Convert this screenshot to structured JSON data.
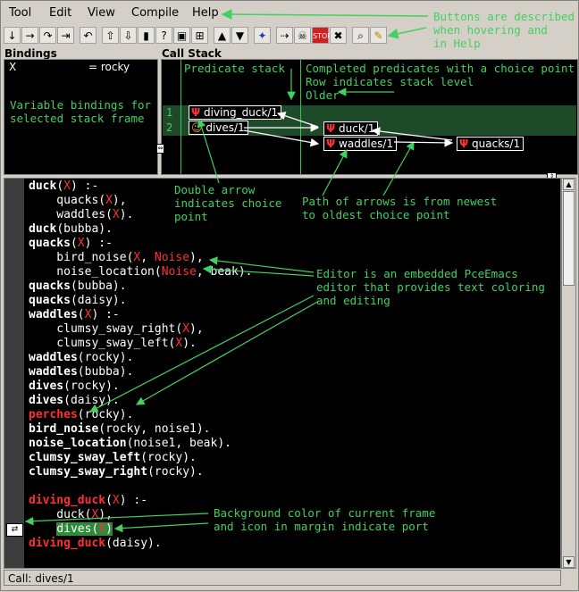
{
  "menu": [
    "Tool",
    "Edit",
    "View",
    "Compile",
    "Help"
  ],
  "toolbar_icons": [
    "step-into-icon",
    "step-over-icon",
    "skip-icon",
    "finish-icon",
    "nodebug-icon",
    "retry-icon",
    "up-icon",
    "down-icon",
    "leap-icon",
    "print-icon",
    "query-icon",
    "abort-icon",
    "break-icon",
    "browse-icon",
    "stack-up-icon",
    "stack-down-icon",
    "spy-icon",
    "nodebug-exit-icon",
    "nodebug-abort-icon",
    "stop-icon",
    "close-icon",
    "search-icon",
    "edit-icon"
  ],
  "panes": {
    "bindings_title": "Bindings",
    "stack_title": "Call Stack"
  },
  "bindings": {
    "var": "X",
    "value": "= rocky"
  },
  "stack": {
    "levels": [
      "1",
      "2"
    ],
    "frames": [
      {
        "label": "diving_duck/1"
      },
      {
        "label": "dives/1"
      },
      {
        "label": "duck/1"
      },
      {
        "label": "waddles/1"
      },
      {
        "label": "quacks/1"
      }
    ]
  },
  "code_lines": [
    [
      {
        "t": "duck",
        "c": "b"
      },
      {
        "t": "("
      },
      {
        "t": "X",
        "c": "r"
      },
      {
        "t": ") :-"
      }
    ],
    [
      {
        "t": "    quacks("
      },
      {
        "t": "X",
        "c": "r"
      },
      {
        "t": "),"
      }
    ],
    [
      {
        "t": "    waddles("
      },
      {
        "t": "X",
        "c": "r"
      },
      {
        "t": ")."
      }
    ],
    [
      {
        "t": "duck",
        "c": "b"
      },
      {
        "t": "(bubba)."
      }
    ],
    [
      {
        "t": "quacks",
        "c": "b"
      },
      {
        "t": "("
      },
      {
        "t": "X",
        "c": "r"
      },
      {
        "t": ") :-"
      }
    ],
    [
      {
        "t": "    bird_noise("
      },
      {
        "t": "X",
        "c": "r"
      },
      {
        "t": ", "
      },
      {
        "t": "Noise",
        "c": "r"
      },
      {
        "t": "),"
      }
    ],
    [
      {
        "t": "    noise_location("
      },
      {
        "t": "Noise",
        "c": "r"
      },
      {
        "t": ", beak)."
      }
    ],
    [
      {
        "t": "quacks",
        "c": "b"
      },
      {
        "t": "(bubba)."
      }
    ],
    [
      {
        "t": "quacks",
        "c": "b"
      },
      {
        "t": "(daisy)."
      }
    ],
    [
      {
        "t": "waddles",
        "c": "b"
      },
      {
        "t": "("
      },
      {
        "t": "X",
        "c": "r"
      },
      {
        "t": ") :-"
      }
    ],
    [
      {
        "t": "    clumsy_sway_right("
      },
      {
        "t": "X",
        "c": "r"
      },
      {
        "t": "),"
      }
    ],
    [
      {
        "t": "    clumsy_sway_left("
      },
      {
        "t": "X",
        "c": "r"
      },
      {
        "t": ")."
      }
    ],
    [
      {
        "t": "waddles",
        "c": "b"
      },
      {
        "t": "(rocky)."
      }
    ],
    [
      {
        "t": "waddles",
        "c": "b"
      },
      {
        "t": "(bubba)."
      }
    ],
    [
      {
        "t": "dives",
        "c": "b"
      },
      {
        "t": "(rocky)."
      }
    ],
    [
      {
        "t": "dives",
        "c": "b"
      },
      {
        "t": "(daisy)."
      }
    ],
    [
      {
        "t": "perches",
        "c": "rb"
      },
      {
        "t": "(rocky)."
      }
    ],
    [
      {
        "t": "bird_noise",
        "c": "b"
      },
      {
        "t": "(rocky, noise1)."
      }
    ],
    [
      {
        "t": "noise_location",
        "c": "b"
      },
      {
        "t": "(noise1, beak)."
      }
    ],
    [
      {
        "t": "clumsy_sway_left",
        "c": "b"
      },
      {
        "t": "(rocky)."
      }
    ],
    [
      {
        "t": "clumsy_sway_right",
        "c": "b"
      },
      {
        "t": "(rocky)."
      }
    ],
    [],
    [
      {
        "t": "diving_duck",
        "c": "rb"
      },
      {
        "t": "("
      },
      {
        "t": "X",
        "c": "r"
      },
      {
        "t": ") :-"
      }
    ],
    [
      {
        "t": "    duck("
      },
      {
        "t": "X",
        "c": "r"
      },
      {
        "t": "),"
      }
    ],
    [
      {
        "t": "    "
      },
      {
        "t": "dives(",
        "c": "hl"
      },
      {
        "t": "X",
        "c": "hlr"
      },
      {
        "t": ")",
        "c": "hl"
      }
    ],
    [
      {
        "t": "diving_duck",
        "c": "rb"
      },
      {
        "t": "(daisy)."
      }
    ]
  ],
  "annotations": {
    "buttons": "Buttons are described\nwhen hovering and\nin Help",
    "predicate_stack": "Predicate stack",
    "completed": "Completed predicates with a choice point\nRow indicates stack level\nOlder",
    "bindings_note": "Variable bindings for\nselected stack frame",
    "double_arrow": "Double arrow\nindicates choice\npoint",
    "path": "Path of arrows is from newest\nto oldest choice point",
    "editor": "Editor is an embedded PceEmacs\neditor that provides text coloring\nand editing",
    "background": "Background color of current frame\nand icon in margin indicate port"
  },
  "status": "Call: dives/1",
  "colors": {
    "note": "#44d060",
    "highlight": "#2e8b3a",
    "variable": "#ff3030"
  }
}
